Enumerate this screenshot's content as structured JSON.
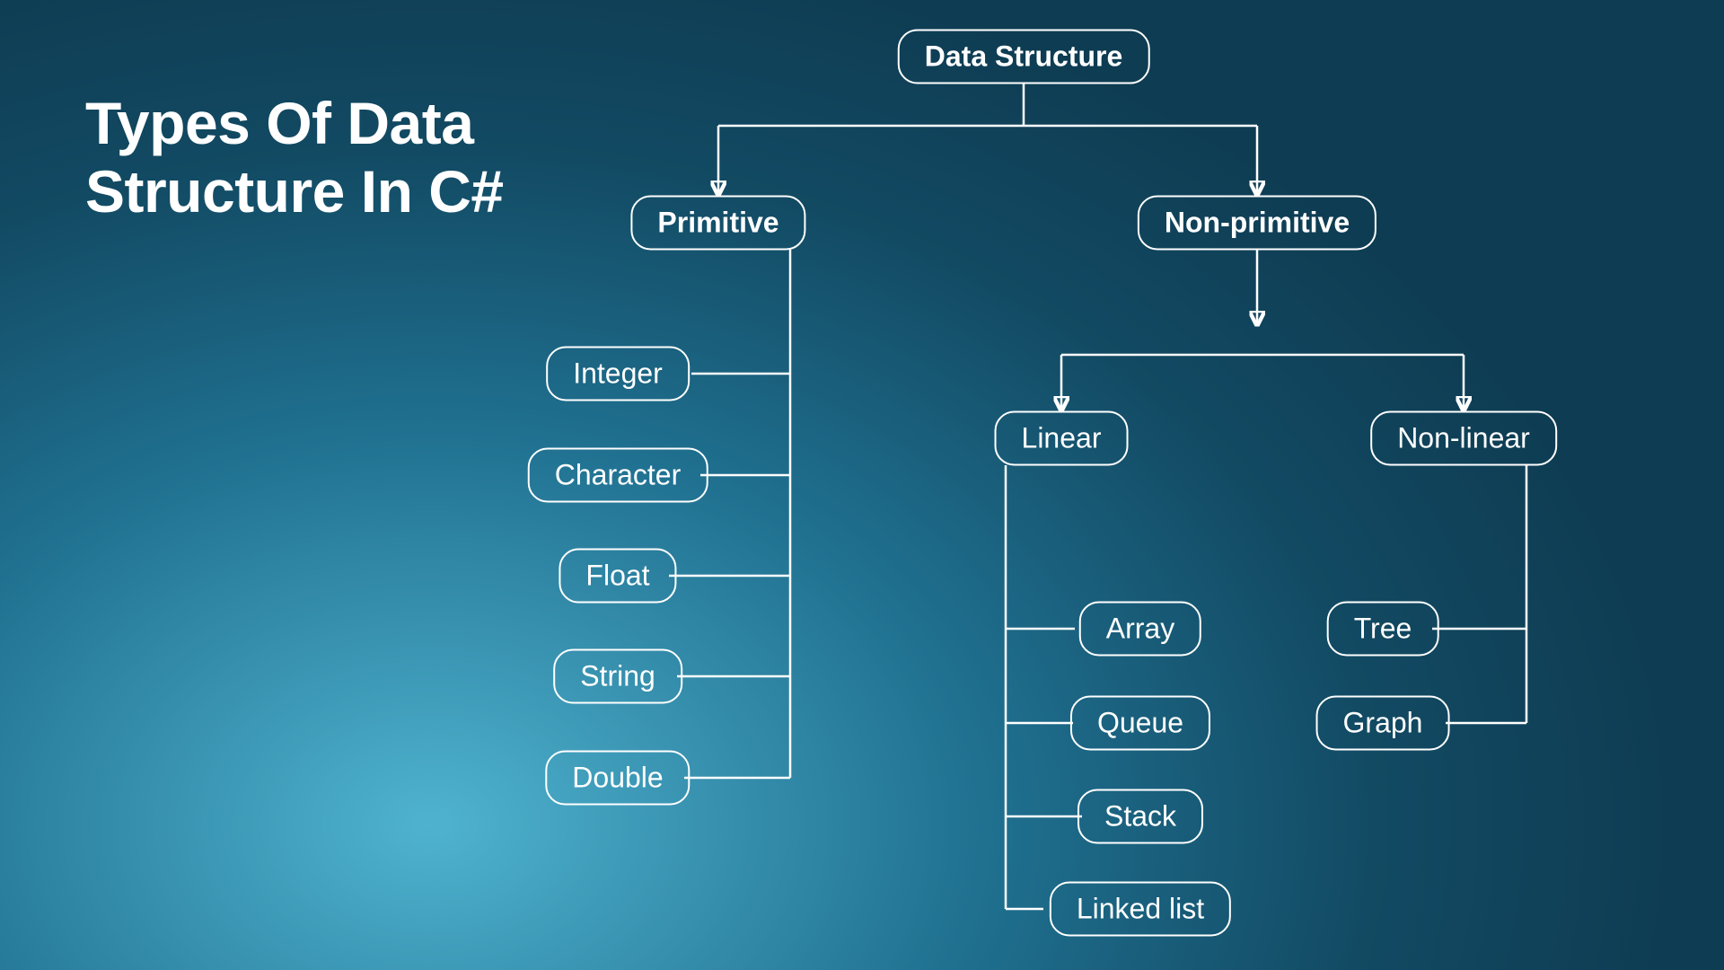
{
  "title": "Types Of Data\nStructure In C#",
  "root": "Data Structure",
  "branches": {
    "primitive": {
      "label": "Primitive",
      "items": [
        "Integer",
        "Character",
        "Float",
        "String",
        "Double"
      ]
    },
    "nonPrimitive": {
      "label": "Non-primitive",
      "children": {
        "linear": {
          "label": "Linear",
          "items": [
            "Array",
            "Queue",
            "Stack",
            "Linked list"
          ]
        },
        "nonLinear": {
          "label": "Non-linear",
          "items": [
            "Tree",
            "Graph"
          ]
        }
      }
    }
  }
}
